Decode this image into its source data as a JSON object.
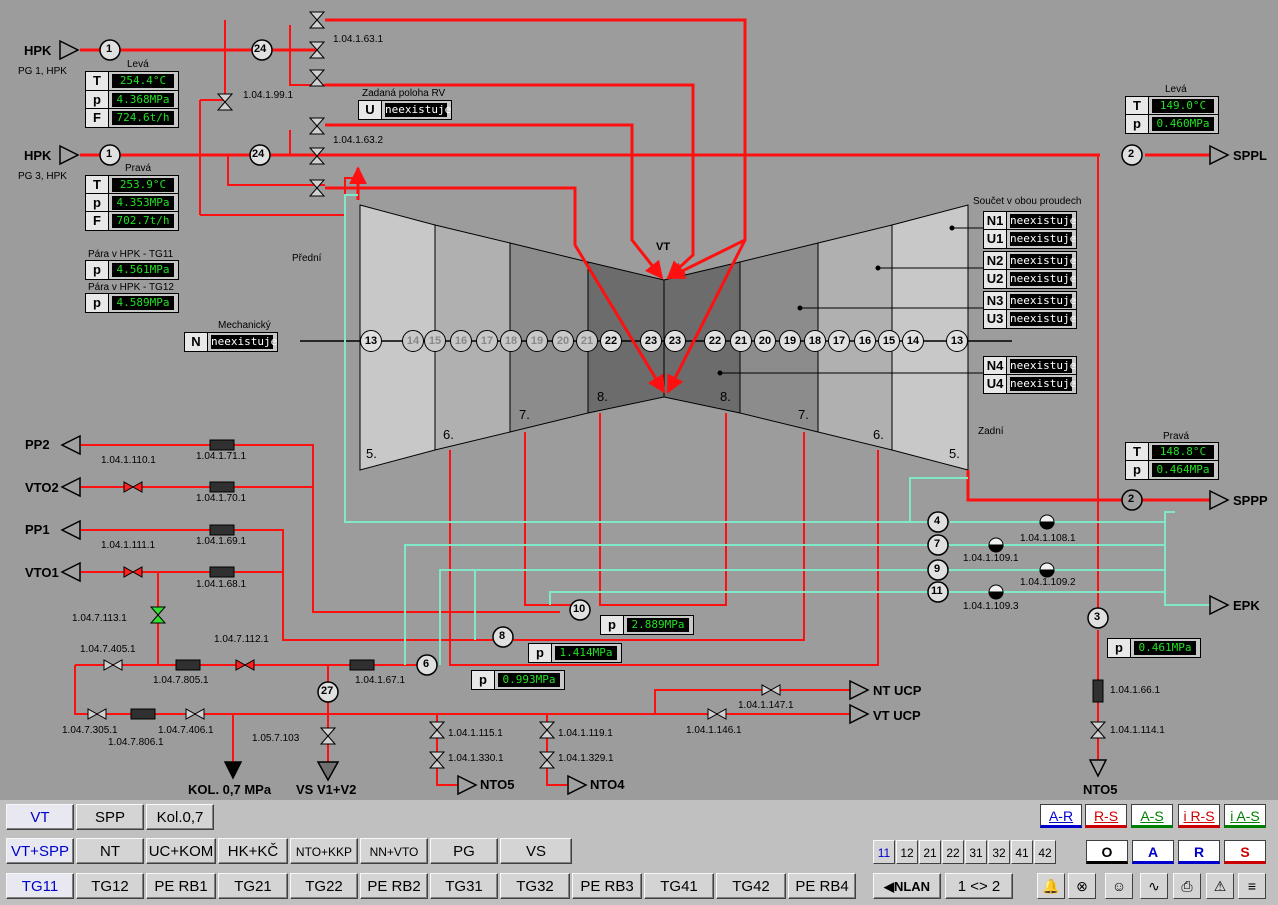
{
  "left_top": {
    "label": "Levá",
    "T": "254.4°C",
    "p": "4.368MPa",
    "F": "724.6t/h",
    "source": "HPK",
    "source_sub": "PG 1, HPK"
  },
  "left_bottom": {
    "label": "Pravá",
    "T": "253.9°C",
    "p": "4.353MPa",
    "F": "702.7t/h",
    "source": "HPK",
    "source_sub": "PG 3, HPK"
  },
  "steam_tg11": {
    "label": "Pára v HPK - TG11",
    "p": "4.561MPa"
  },
  "steam_tg12": {
    "label": "Pára v HPK - TG12",
    "p": "4.589MPa"
  },
  "right_top": {
    "label": "Levá",
    "T": "149.0°C",
    "p": "0.460MPa",
    "dest": "SPPL"
  },
  "right_bottom": {
    "label": "Pravá",
    "T": "148.8°C",
    "p": "0.464MPa",
    "dest": "SPPP"
  },
  "rv": {
    "label": "Zadaná poloha RV",
    "key": "U",
    "value": "neexistuje"
  },
  "mech": {
    "label": "Mechanický",
    "key": "N",
    "value": "neexistuje"
  },
  "sum": {
    "label": "Součet v obou proudech",
    "rows": [
      {
        "k": "N1",
        "v": "neexistuje"
      },
      {
        "k": "U1",
        "v": "neexistuje"
      },
      {
        "k": "N2",
        "v": "neexistuje"
      },
      {
        "k": "U2",
        "v": "neexistuje"
      },
      {
        "k": "N3",
        "v": "neexistuje"
      },
      {
        "k": "U3",
        "v": "neexistuje"
      },
      {
        "k": "N4",
        "v": "neexistuje"
      },
      {
        "k": "U4",
        "v": "neexistuje"
      }
    ]
  },
  "turbine": {
    "vt": "VT",
    "front": "Přední",
    "rear": "Zadní",
    "stages_left": [
      "5.",
      "6.",
      "7.",
      "8."
    ],
    "stages_right": [
      "8.",
      "7.",
      "6.",
      "5."
    ],
    "taps_left": [
      "13",
      "14",
      "15",
      "16",
      "17",
      "18",
      "19",
      "20",
      "21",
      "22",
      "23"
    ],
    "taps_right": [
      "23",
      "22",
      "21",
      "20",
      "19",
      "18",
      "17",
      "16",
      "15",
      "14",
      "13"
    ]
  },
  "nodes": {
    "n1a": "1",
    "n1b": "1",
    "n24a": "24",
    "n24b": "24",
    "n2a": "2",
    "n2b": "2",
    "n3": "3",
    "n4": "4",
    "n7": "7",
    "n9": "9",
    "n11": "11",
    "n10": "10",
    "n8": "8",
    "n6": "6",
    "n27": "27"
  },
  "meters": {
    "m10": "2.889MPa",
    "m8": "1.414MPa",
    "m6": "0.993MPa",
    "m3": "0.461MPa"
  },
  "valves": {
    "v1631": "1.04.1.63.1",
    "v1632": "1.04.1.63.2",
    "v1991": "1.04.1.99.1",
    "v1108": "1.04.1.108.1",
    "v1109_1": "1.04.1.109.1",
    "v1109_2": "1.04.1.109.2",
    "v1109_3": "1.04.1.109.3",
    "v1110": "1.04.1.110.1",
    "v171": "1.04.1.71.1",
    "v170": "1.04.1.70.1",
    "v1111": "1.04.1.111.1",
    "v169": "1.04.1.69.1",
    "v168": "1.04.1.68.1",
    "v7113": "1.04.7.113.1",
    "v7405": "1.04.7.405.1",
    "v7805": "1.04.7.805.1",
    "v7112": "1.04.7.112.1",
    "v7305": "1.04.7.305.1",
    "v7806": "1.04.7.806.1",
    "v7406": "1.04.7.406.1",
    "v167": "1.04.1.67.1",
    "v5103": "1.05.7.103",
    "v1115": "1.04.1.115.1",
    "v1330": "1.04.1.330.1",
    "v1119": "1.04.1.119.1",
    "v1329": "1.04.1.329.1",
    "v1147": "1.04.1.147.1",
    "v1146": "1.04.1.146.1",
    "v166": "1.04.1.66.1",
    "v1114": "1.04.1.114.1"
  },
  "outlets": {
    "pp2": "PP2",
    "vto2": "VTO2",
    "pp1": "PP1",
    "vto1": "VTO1",
    "epk": "EPK",
    "ntucp": "NT UCP",
    "vtucp": "VT UCP",
    "nto5a": "NTO5",
    "nto4": "NTO4",
    "nto5b": "NTO5",
    "kol": "KOL. 0,7 MPa",
    "vs": "VS V1+V2"
  },
  "toolbar": {
    "row1": [
      "VT",
      "SPP",
      "Kol.0,7"
    ],
    "row2": [
      "VT+SPP",
      "NT",
      "UC+KOM",
      "HK+KČ",
      "NTO+KKP",
      "NN+VTO",
      "PG",
      "VS"
    ],
    "row3": [
      "TG11",
      "TG12",
      "PE RB1",
      "TG21",
      "TG22",
      "PE RB2",
      "TG31",
      "TG32",
      "PE RB3",
      "TG41",
      "TG42",
      "PE RB4"
    ],
    "nums": [
      "11",
      "12",
      "21",
      "22",
      "31",
      "32",
      "41",
      "42"
    ],
    "modes1": [
      "A-R",
      "R-S",
      "A-S",
      "i R-S",
      "i A-S"
    ],
    "modes2": [
      "O",
      "A",
      "R",
      "S"
    ],
    "nlan": "NLAN",
    "swap": "1 <> 2"
  },
  "colors": {
    "steam": "#ff1010",
    "cond": "#80e8c8",
    "meter": "#22e022"
  }
}
